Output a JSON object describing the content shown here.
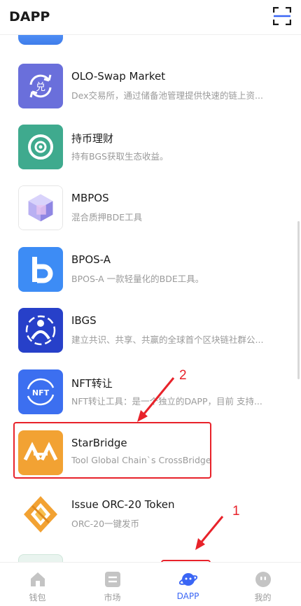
{
  "header": {
    "title": "DAPP"
  },
  "dapps": [
    {
      "name": "OLO-Swap Market",
      "desc": "Dex交易所，通过储备池管理提供快速的链上资...",
      "icon": "swap-exchange-icon",
      "color": "#6a6fdb"
    },
    {
      "name": "持币理财",
      "desc": "持有BGS获取生态收益。",
      "icon": "target-coin-icon",
      "color": "#3faa8e"
    },
    {
      "name": "MBPOS",
      "desc": "混合质押BDE工具",
      "icon": "cube-icon",
      "color": "#9b8be8"
    },
    {
      "name": "BPOS-A",
      "desc": "BPOS-A 一款轻量化的BDE工具。",
      "icon": "letter-b-icon",
      "color": "#3d8cf5"
    },
    {
      "name": "IBGS",
      "desc": "建立共识、共享、共赢的全球首个区块链社群公...",
      "icon": "people-ring-icon",
      "color": "#2740c9"
    },
    {
      "name": "NFT转让",
      "desc": "NFT转让工具：是一个独立的DAPP，目前 支持...",
      "icon": "nft-transfer-icon",
      "color": "#3c6ff0"
    },
    {
      "name": "StarBridge",
      "desc": "Tool Global Chain`s CrossBridge",
      "icon": "starbridge-icon",
      "color": "#f2a233"
    },
    {
      "name": "Issue ORC-20 Token",
      "desc": "ORC-20一键发币",
      "icon": "orc20-token-icon",
      "color": "#f2a233"
    }
  ],
  "tabs": [
    {
      "label": "钱包",
      "icon": "home-icon",
      "active": false
    },
    {
      "label": "市场",
      "icon": "market-icon",
      "active": false
    },
    {
      "label": "DAPP",
      "icon": "planet-icon",
      "active": true
    },
    {
      "label": "我的",
      "icon": "profile-face-icon",
      "active": false
    }
  ],
  "annotations": {
    "one": "1",
    "two": "2"
  },
  "colors": {
    "active": "#3b66f5",
    "inactive": "#c4c4c4",
    "annotation": "#e8222a"
  }
}
